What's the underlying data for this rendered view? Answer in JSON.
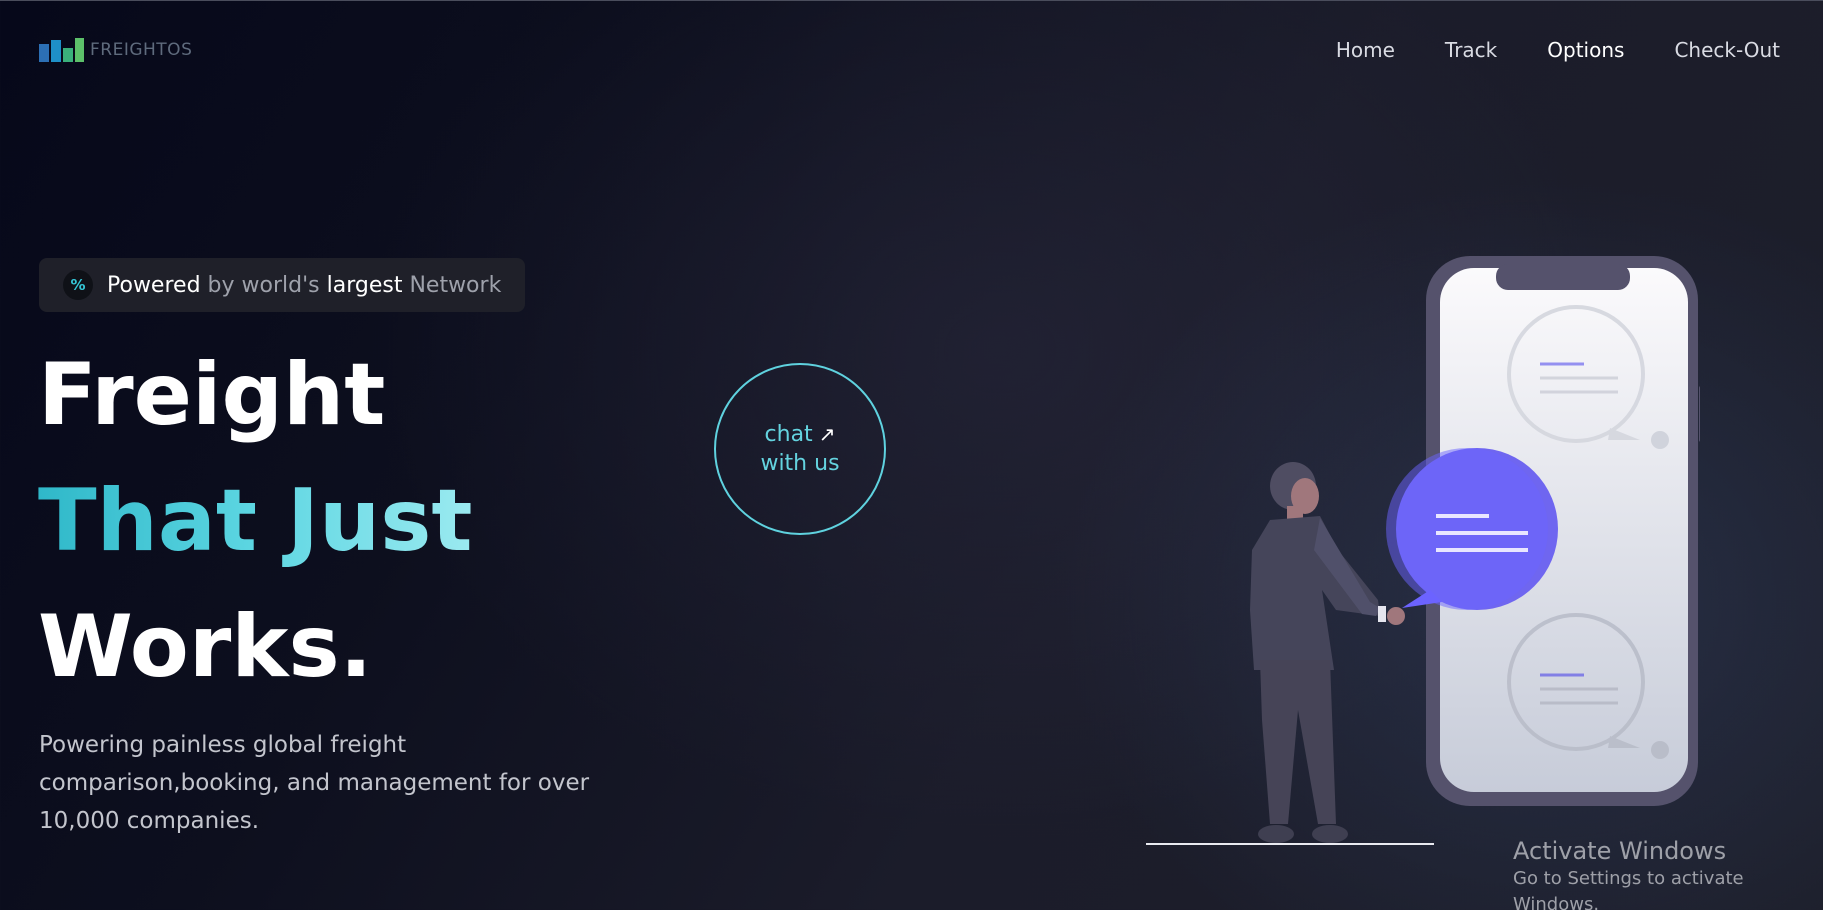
{
  "brand": {
    "name": "FREIGHTOS",
    "colors": {
      "bar1": "#2c6fb4",
      "bar2": "#1e90c8",
      "bar3": "#3ab07b",
      "bar4": "#5cc06a"
    }
  },
  "nav": {
    "items": [
      {
        "label": "Home",
        "active": false
      },
      {
        "label": "Track",
        "active": false
      },
      {
        "label": "Options",
        "active": true
      },
      {
        "label": "Check-Out",
        "active": false
      }
    ]
  },
  "badge": {
    "icon": "percent-icon",
    "icon_glyph": "%",
    "word1": "Powered",
    "word2": " by world's ",
    "word3": "largest",
    "word4": " Network"
  },
  "hero": {
    "line1": "Freight",
    "line2": "That Just",
    "line3": "Works.",
    "description": "Powering painless global freight comparison,booking, and management for over 10,000 companies."
  },
  "chat": {
    "line1": "chat",
    "line2": "with us",
    "icon": "arrow-up-right-icon",
    "icon_glyph": "↗"
  },
  "illustration": {
    "name": "person-with-phone-chat-illustration",
    "accent_color": "#6c63ff"
  },
  "os_watermark": {
    "title": "Activate Windows",
    "subtitle": "Go to Settings to activate Windows."
  }
}
